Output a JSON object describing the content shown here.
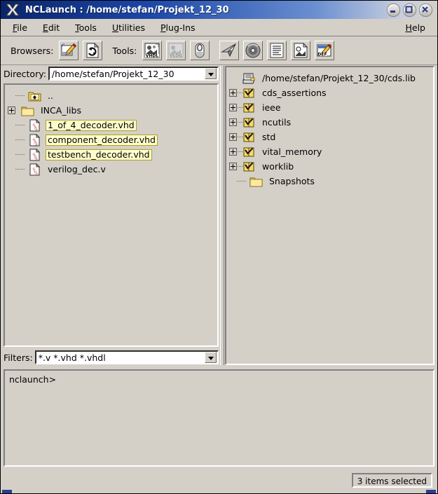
{
  "window": {
    "title": "NCLaunch : /home/stefan/Projekt_12_30",
    "logo_icon": "x-window-logo-icon",
    "minimize_label": "–",
    "maximize_label": "□",
    "close_label": "✕"
  },
  "menubar": {
    "items": [
      {
        "mnemonic": "F",
        "rest": "ile",
        "name": "file"
      },
      {
        "mnemonic": "E",
        "rest": "dit",
        "name": "edit"
      },
      {
        "mnemonic": "T",
        "rest": "ools",
        "name": "tools"
      },
      {
        "mnemonic": "U",
        "rest": "tilities",
        "name": "utilities"
      },
      {
        "mnemonic": "P",
        "rest": "lug-Ins",
        "name": "plug-ins"
      }
    ],
    "help": {
      "mnemonic": "H",
      "rest": "elp",
      "name": "help"
    }
  },
  "toolbar": {
    "browsers_label": "Browsers:",
    "tools_label": "Tools:",
    "buttons": [
      {
        "name": "design-browser-button",
        "icon": "pencil-document-icon"
      },
      {
        "name": "library-browser-button",
        "icon": "document-refresh-icon"
      },
      {
        "name": "vhdl-compiler-button",
        "icon": "vhdl-compile-icon",
        "badge": "VHDL"
      },
      {
        "name": "verilog-compiler-button",
        "icon": "verilog-compile-icon",
        "badge": "VLOG",
        "disabled": true
      },
      {
        "name": "elaborator-button",
        "icon": "elaborate-icon"
      },
      {
        "name": "simulator-button",
        "icon": "paper-plane-icon"
      },
      {
        "name": "simvision-button",
        "icon": "disc-icon"
      },
      {
        "name": "waveform-button",
        "icon": "list-lines-icon"
      },
      {
        "name": "schematic-button",
        "icon": "document-shapes-icon"
      },
      {
        "name": "cds-lib-editor-button",
        "icon": "pencil-def-icon",
        "badge": "DEF"
      }
    ]
  },
  "left_pane": {
    "directory": {
      "label": "Directory:",
      "value": "/home/stefan/Projekt_12_30"
    },
    "filters": {
      "label": "Filters:",
      "value": "*.v *.vhd *.vhdl"
    },
    "tree": [
      {
        "label": "..",
        "icon": "folder-up-icon",
        "expander": false,
        "selected": false,
        "indent": 1
      },
      {
        "label": "INCA_libs",
        "icon": "folder-icon",
        "expander": true,
        "selected": false,
        "indent": 0
      },
      {
        "label": "1_of_4_decoder.vhd",
        "icon": "vhdl-file-icon",
        "expander": false,
        "selected": true,
        "indent": 1
      },
      {
        "label": "component_decoder.vhd",
        "icon": "vhdl-file-icon",
        "expander": false,
        "selected": true,
        "indent": 1
      },
      {
        "label": "testbench_decoder.vhd",
        "icon": "vhdl-file-icon",
        "expander": false,
        "selected": true,
        "indent": 1
      },
      {
        "label": "verilog_dec.v",
        "icon": "vlog-file-icon",
        "expander": false,
        "selected": false,
        "indent": 1
      }
    ]
  },
  "right_pane": {
    "tree": [
      {
        "label": "/home/stefan/Projekt_12_30/cds.lib",
        "icon": "cds-lib-root-icon",
        "expander": false,
        "indent": 0,
        "root": true
      },
      {
        "label": "cds_assertions",
        "icon": "library-icon",
        "expander": true,
        "indent": 1
      },
      {
        "label": "ieee",
        "icon": "library-icon",
        "expander": true,
        "indent": 1
      },
      {
        "label": "ncutils",
        "icon": "library-icon",
        "expander": true,
        "indent": 1
      },
      {
        "label": "std",
        "icon": "library-icon",
        "expander": true,
        "indent": 1
      },
      {
        "label": "vital_memory",
        "icon": "library-icon",
        "expander": true,
        "indent": 1
      },
      {
        "label": "worklib",
        "icon": "library-icon",
        "expander": true,
        "indent": 1
      },
      {
        "label": "Snapshots",
        "icon": "folder-icon",
        "expander": false,
        "indent": 1
      }
    ]
  },
  "console": {
    "prompt": "nclaunch>"
  },
  "statusbar": {
    "selection_text": "3 items selected"
  },
  "colors": {
    "face": "#d4d0c8",
    "title_start": "#0a246a",
    "selection_fill": "#ffffcc",
    "selection_border": "#b0a020",
    "folder_yellow": "#f5d76e",
    "text": "#000000"
  }
}
